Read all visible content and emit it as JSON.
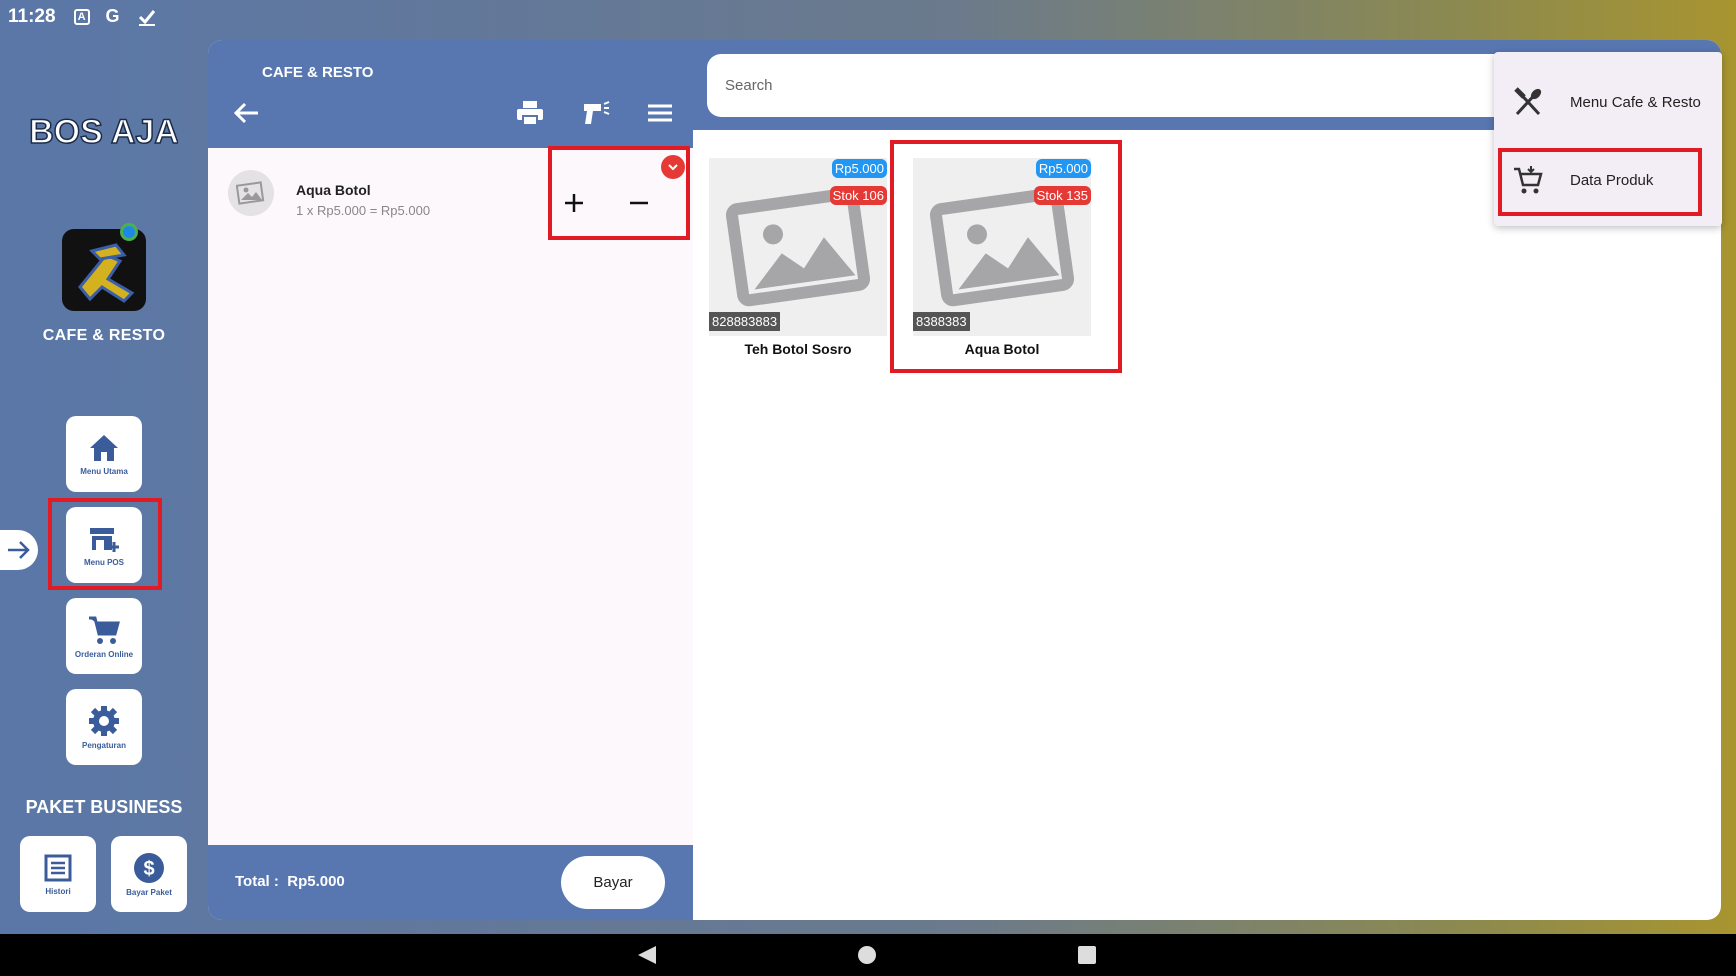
{
  "status_bar": {
    "time": "11:28"
  },
  "rail": {
    "brand": "BOS AJA",
    "title": "CAFE & RESTO",
    "buttons": [
      {
        "label": "Menu Utama",
        "icon": "home-icon"
      },
      {
        "label": "Menu POS",
        "icon": "store-add-icon"
      },
      {
        "label": "Orderan Online",
        "icon": "cart-icon"
      },
      {
        "label": "Pengaturan",
        "icon": "gear-icon"
      }
    ],
    "section_title": "PAKET BUSINESS",
    "package_buttons": [
      {
        "label": "Histori",
        "icon": "list-icon"
      },
      {
        "label": "Bayar Paket",
        "icon": "dollar-icon"
      }
    ]
  },
  "cart": {
    "title": "CAFE & RESTO",
    "items": [
      {
        "name": "Aqua Botol",
        "detail": "1 x Rp5.000 = Rp5.000"
      }
    ],
    "total_label": "Total :",
    "total_value": "Rp5.000",
    "pay_label": "Bayar"
  },
  "search": {
    "placeholder": "Search"
  },
  "products": [
    {
      "name": "Teh Botol Sosro",
      "price": "Rp5.000",
      "stock": "Stok 106",
      "sku": "828883883"
    },
    {
      "name": "Aqua Botol",
      "price": "Rp5.000",
      "stock": "Stok 135",
      "sku": "8388383"
    }
  ],
  "menu": {
    "items": [
      {
        "label": "Menu Cafe & Resto",
        "icon": "fork-knife-icon"
      },
      {
        "label": "Data Produk",
        "icon": "cart-icon"
      }
    ]
  },
  "colors": {
    "header_blue": "#5877b0",
    "price_blue": "#2196f3",
    "stock_red": "#e53935",
    "highlight_red": "#e01b24"
  }
}
